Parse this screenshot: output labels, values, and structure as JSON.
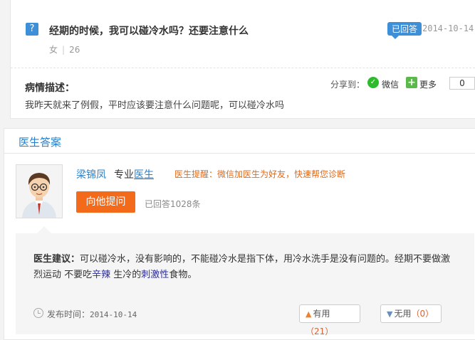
{
  "question": {
    "icon_text": "?",
    "title": "经期的时候，我可以碰冷水吗？还要注意什么",
    "gender": "女",
    "age": "26",
    "status_badge": "已回答",
    "date": "2014-10-14",
    "description_label": "病情描述：",
    "description": "我昨天就来了例假，平时应该要注意什么问题呢，可以碰冷水吗"
  },
  "share": {
    "label": "分享到：",
    "wechat_icon_text": "✓",
    "wechat": "微信",
    "more_icon_text": "+",
    "more": "更多",
    "count": "0"
  },
  "answer_section": {
    "header": "医生答案",
    "doctor_name": "梁锦凤",
    "doctor_title_prefix": "专业",
    "doctor_title_link": "医生",
    "tip": "医生提醒：微信加医生为好友，快速帮您诊断",
    "ask_button": "向他提问",
    "answer_count": "已回答1028条",
    "advice_label": "医生建议：",
    "advice_part1": "可以碰冷水，没有影响的，不能碰冷水是指下体，用冷水洗手是没有问题的。经期不要做激烈运动  不要吃",
    "advice_kw1": "辛辣",
    "advice_part2": " 生冷的",
    "advice_kw2": "刺激性",
    "advice_part3": "食物。",
    "publish_label": "发布时间：",
    "publish_date": "2014-10-14",
    "useful_label": "有用",
    "useful_count": "（21）",
    "useless_label": "无用",
    "useless_count": "（0）"
  },
  "colors": {
    "accent_blue": "#3d8fd8",
    "button_orange": "#f26a1a",
    "tip_orange": "#e06a1a",
    "wechat_green": "#2dbb2d"
  },
  "icons": [
    "question-icon",
    "wechat-icon",
    "plus-icon",
    "doctor-avatar",
    "clock-icon",
    "thumbs-up-icon",
    "thumbs-down-icon"
  ]
}
